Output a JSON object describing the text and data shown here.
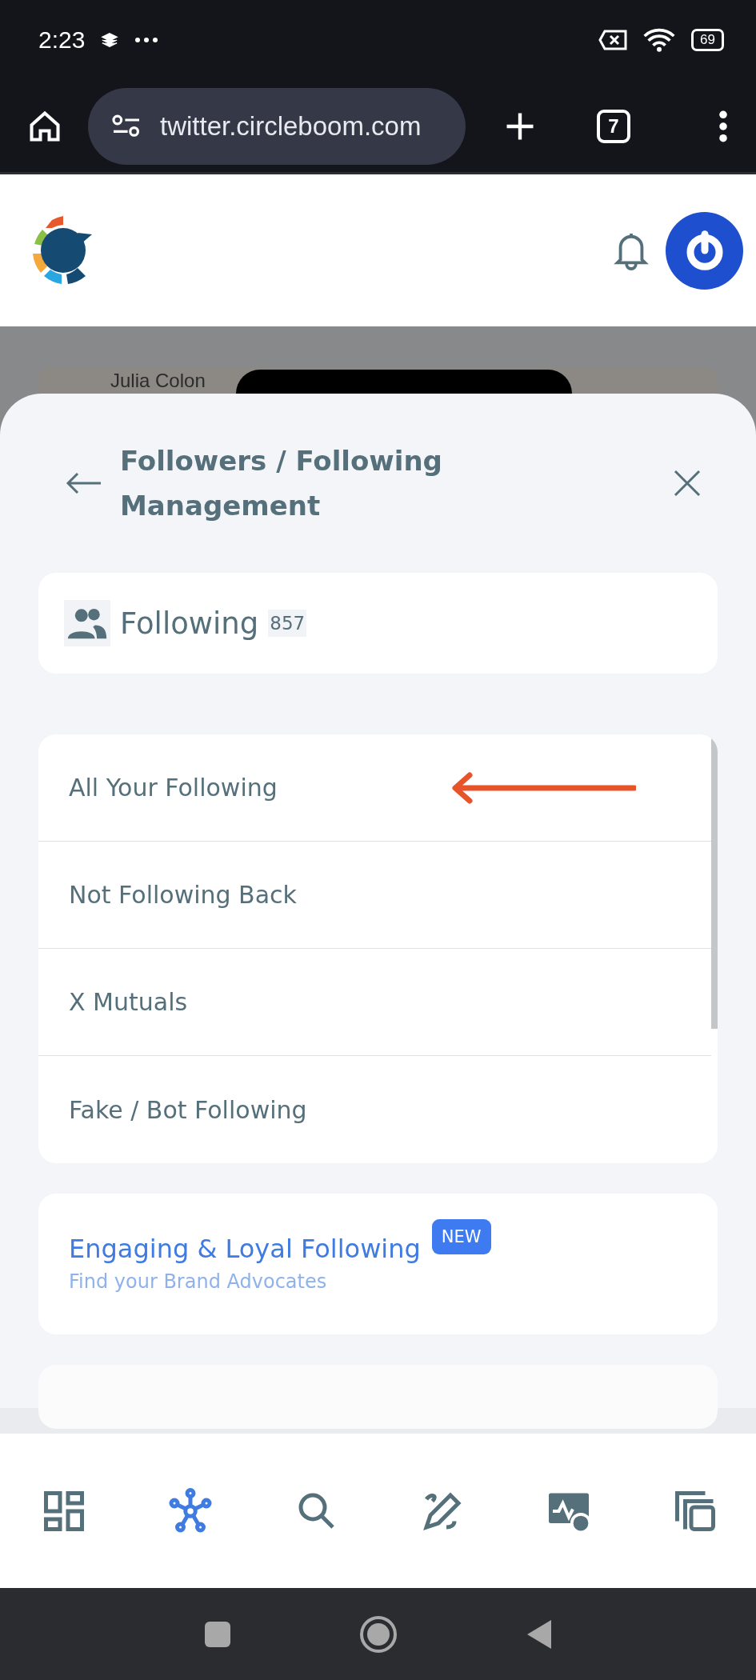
{
  "status_bar": {
    "time": "2:23",
    "battery": "69"
  },
  "browser": {
    "url": "twitter.circleboom.com",
    "tab_count": "7"
  },
  "backdrop": {
    "name": "Julia Colon"
  },
  "sheet": {
    "title": "Followers / Following Management",
    "summary": {
      "label": "Following",
      "count": "857"
    },
    "menu": [
      {
        "label": "All Your Following",
        "marked": true
      },
      {
        "label": "Not Following Back",
        "marked": false
      },
      {
        "label": "X Mutuals",
        "marked": false
      },
      {
        "label": "Fake / Bot Following",
        "marked": false
      }
    ],
    "promo": {
      "title": "Engaging & Loyal Following",
      "subtitle": "Find your Brand Advocates",
      "badge": "NEW"
    }
  },
  "bottom_nav": [
    {
      "kind": "dashboard",
      "selected": false
    },
    {
      "kind": "network",
      "selected": true
    },
    {
      "kind": "search",
      "selected": false
    },
    {
      "kind": "write",
      "selected": false
    },
    {
      "kind": "monitor",
      "selected": false
    },
    {
      "kind": "copy",
      "selected": false
    }
  ]
}
